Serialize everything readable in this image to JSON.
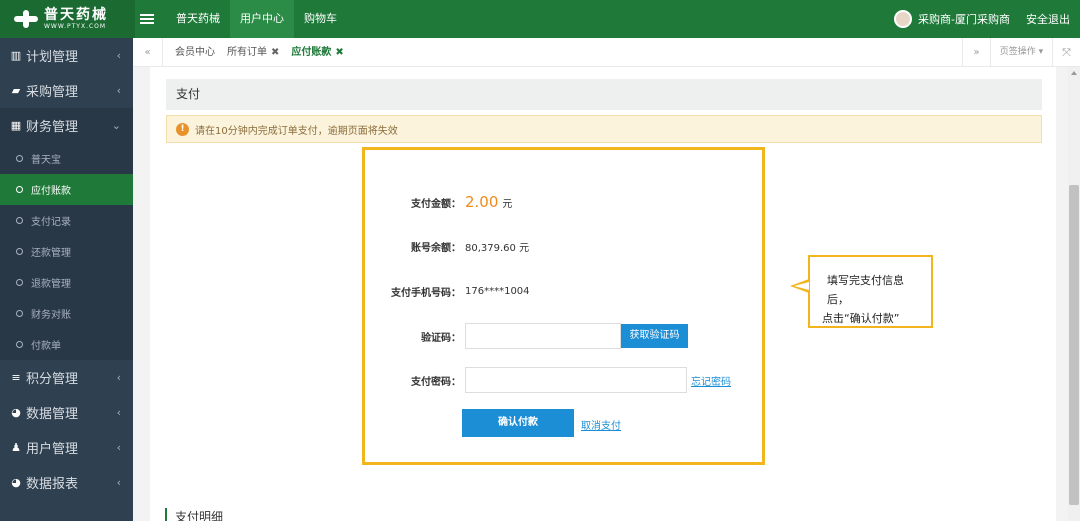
{
  "topbar": {
    "logo_name": "普天药械",
    "logo_url": "WWW.PTYX.COM",
    "nav": [
      "普天药械",
      "用户中心",
      "购物车"
    ],
    "active_nav": "用户中心",
    "user_label": "采购商-厦门采购商",
    "logout_label": "安全退出"
  },
  "sidebar": {
    "items_top": [
      {
        "label": "计划管理",
        "icon": "bar-chart-icon"
      },
      {
        "label": "采购管理",
        "icon": "briefcase-icon"
      },
      {
        "label": "财务管理",
        "icon": "calculator-icon"
      }
    ],
    "submenu": [
      "普天宝",
      "应付账款",
      "支付记录",
      "还款管理",
      "退款管理",
      "财务对账",
      "付款单"
    ],
    "active_sub": "应付账款",
    "items_bottom": [
      {
        "label": "积分管理",
        "icon": "database-icon"
      },
      {
        "label": "数据管理",
        "icon": "pie-chart-icon"
      },
      {
        "label": "用户管理",
        "icon": "user-icon"
      },
      {
        "label": "数据报表",
        "icon": "pie-chart-icon"
      }
    ]
  },
  "tabs": {
    "items": [
      "会员中心",
      "所有订单",
      "应付账款"
    ],
    "active": "应付账款",
    "ops_label": "页签操作"
  },
  "page": {
    "panel_title": "支付",
    "warning": "请在10分钟内完成订单支付，逾期页面将失效",
    "detail_title": "支付明细"
  },
  "modal": {
    "amount_label": "支付金额：",
    "amount_value": "2.00",
    "amount_unit": "元",
    "balance_label": "账号余额：",
    "balance_value": "80,379.60 元",
    "phone_label": "支付手机号码：",
    "phone_value": "176****1004",
    "code_label": "验证码：",
    "code_value": "",
    "get_code_button": "获取验证码",
    "password_label": "支付密码：",
    "password_value": "",
    "forgot_link": "忘记密码",
    "confirm_button": "确认付款",
    "cancel_link": "取消支付"
  },
  "callout": {
    "line1": "填写完支付信息后，",
    "line2": "点击“确认付款”"
  },
  "colors": {
    "brand_green": "#1f7a3a",
    "sidebar_bg": "#2f4050",
    "accent_blue": "#1c8ed6",
    "highlight_orange": "#f08a1c",
    "callout_border": "#f2b51e"
  }
}
